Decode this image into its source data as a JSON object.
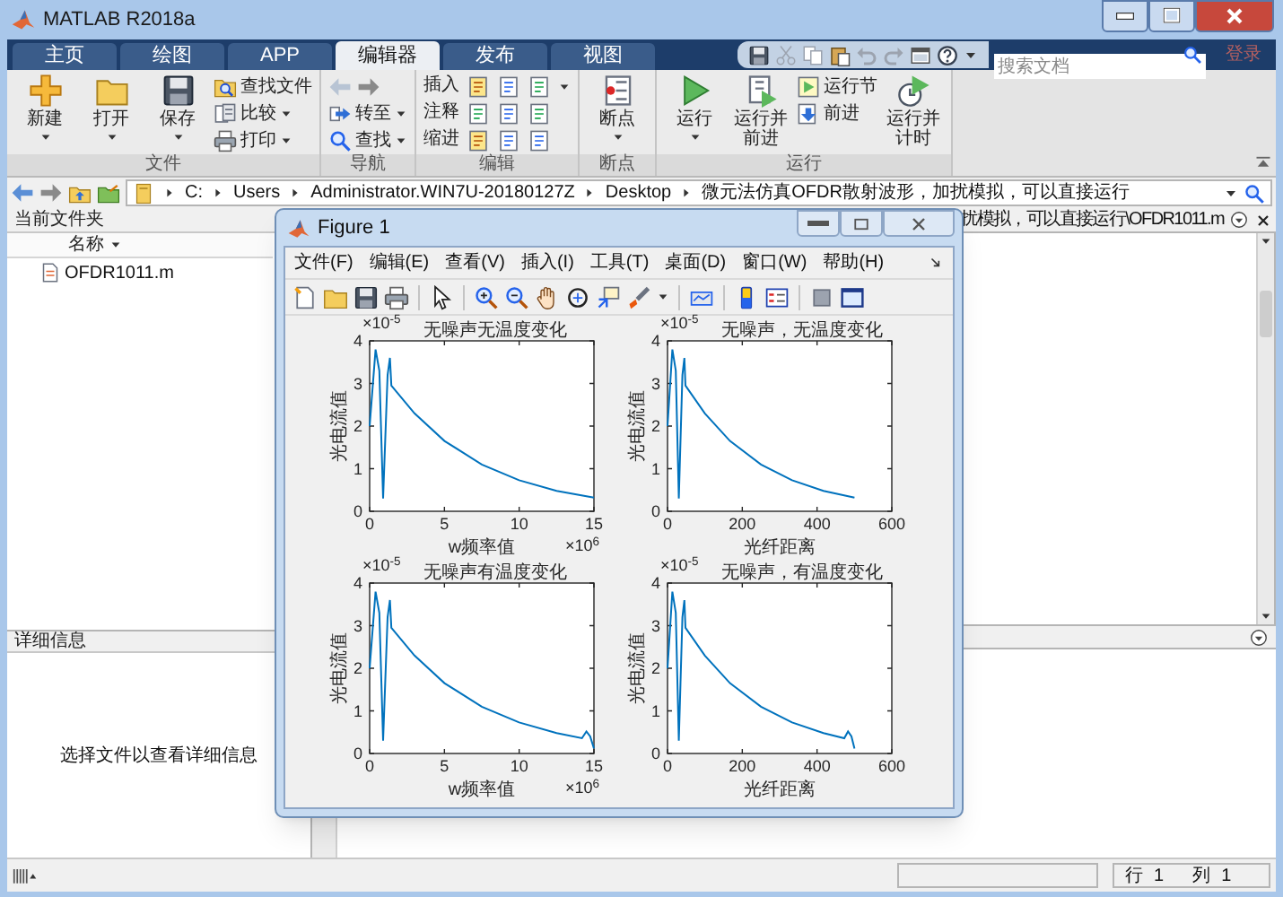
{
  "window": {
    "title": "MATLAB R2018a"
  },
  "tabs": [
    {
      "label": "主页",
      "selected": false
    },
    {
      "label": "绘图",
      "selected": false
    },
    {
      "label": "APP",
      "selected": false
    },
    {
      "label": "编辑器",
      "selected": true
    },
    {
      "label": "发布",
      "selected": false
    },
    {
      "label": "视图",
      "selected": false
    }
  ],
  "search": {
    "placeholder": "搜索文档"
  },
  "sign_in": "登录",
  "ribbon": {
    "groups": [
      {
        "label": "文件",
        "items": [
          {
            "kind": "large",
            "label": "新建",
            "dropdown": true
          },
          {
            "kind": "large",
            "label": "打开",
            "dropdown": true
          },
          {
            "kind": "large",
            "label": "保存",
            "dropdown": true
          },
          {
            "kind": "small",
            "label": "查找文件",
            "dropdown": false
          },
          {
            "kind": "small",
            "label": "比较",
            "dropdown": true
          },
          {
            "kind": "small",
            "label": "打印",
            "dropdown": true
          }
        ]
      },
      {
        "label": "导航",
        "items": [
          {
            "kind": "arrows",
            "disabled": true
          },
          {
            "kind": "small",
            "label": "转至",
            "dropdown": true
          },
          {
            "kind": "small",
            "label": "查找",
            "dropdown": true
          }
        ]
      },
      {
        "label": "编辑",
        "items": [
          {
            "kind": "tool_row",
            "label": "插入",
            "dropdown": true
          },
          {
            "kind": "tool_row",
            "label": "注释",
            "dropdown": false
          },
          {
            "kind": "tool_row",
            "label": "缩进",
            "dropdown": false
          }
        ]
      },
      {
        "label": "断点",
        "items": [
          {
            "kind": "large",
            "label": "断点",
            "dropdown": true
          }
        ]
      },
      {
        "label": "运行",
        "items": [
          {
            "kind": "large",
            "label": "运行",
            "dropdown": true
          },
          {
            "kind": "large",
            "label": "运行并前进",
            "dropdown": false
          },
          {
            "kind": "small",
            "label": "运行节",
            "dropdown": false
          },
          {
            "kind": "small",
            "label": "前进",
            "dropdown": false
          },
          {
            "kind": "large",
            "label": "运行并计时",
            "dropdown": false
          }
        ]
      }
    ]
  },
  "address": {
    "segments": [
      "C:",
      "Users",
      "Administrator.WIN7U-20180127Z",
      "Desktop",
      "微元法仿真OFDR散射波形，加扰模拟，可以直接运行"
    ]
  },
  "current_folder": {
    "title": "当前文件夹",
    "column": "名称",
    "files": [
      "OFDR1011.m"
    ]
  },
  "editor": {
    "title": "扰模拟，可以直接运行\\OFDR1011.m"
  },
  "details": {
    "title": "详细信息",
    "message": "选择文件以查看详细信息"
  },
  "status_bar": {
    "line_label": "行",
    "line": "1",
    "col_label": "列",
    "col": "1"
  },
  "figure": {
    "title": "Figure 1",
    "menu": [
      "文件(F)",
      "编辑(E)",
      "查看(V)",
      "插入(I)",
      "工具(T)",
      "桌面(D)",
      "窗口(W)",
      "帮助(H)"
    ],
    "plots": [
      {
        "y_multiplier": "×10$^{-5}$",
        "x_multiplier": "×10$^{6}$",
        "chart_data": {
          "type": "line",
          "title": "无噪声无温度变化",
          "xlabel": "w频率值",
          "ylabel": "光电流值",
          "x": [
            0,
            0.4,
            0.65,
            0.9,
            1.2,
            1.35,
            1.45,
            3,
            5,
            7.5,
            10,
            12.5,
            15
          ],
          "series": [
            {
              "color": "#0072bd",
              "values": [
                2,
                3.8,
                3.3,
                0.3,
                3.2,
                3.6,
                2.95,
                2.3,
                1.65,
                1.1,
                0.73,
                0.48,
                0.32
              ]
            }
          ],
          "xlim": [
            0,
            15
          ],
          "ylim": [
            0,
            4
          ],
          "xticks": [
            0,
            5,
            10,
            15
          ],
          "yticks": [
            0,
            1,
            2,
            3,
            4
          ]
        }
      },
      {
        "y_multiplier": "×10$^{-5}$",
        "chart_data": {
          "type": "line",
          "title": "无噪声，无温度变化",
          "xlabel": "光纤距离",
          "ylabel": "光电流值",
          "x": [
            0,
            13,
            22,
            30,
            40,
            45,
            48,
            100,
            167,
            250,
            333,
            417,
            500
          ],
          "series": [
            {
              "color": "#0072bd",
              "values": [
                2,
                3.8,
                3.3,
                0.3,
                3.2,
                3.6,
                2.95,
                2.3,
                1.65,
                1.1,
                0.73,
                0.48,
                0.32
              ]
            }
          ],
          "xlim": [
            0,
            600
          ],
          "ylim": [
            0,
            4
          ],
          "xticks": [
            0,
            200,
            400,
            600
          ],
          "yticks": [
            0,
            1,
            2,
            3,
            4
          ]
        }
      },
      {
        "y_multiplier": "×10$^{-5}$",
        "x_multiplier": "×10$^{6}$",
        "chart_data": {
          "type": "line",
          "title": "无噪声有温度变化",
          "xlabel": "w频率值",
          "ylabel": "光电流值",
          "x": [
            0,
            0.4,
            0.65,
            0.9,
            1.2,
            1.35,
            1.45,
            3,
            5,
            7.5,
            10,
            12.5,
            14.2,
            14.5,
            14.75,
            15
          ],
          "series": [
            {
              "color": "#0072bd",
              "values": [
                2,
                3.8,
                3.3,
                0.3,
                3.2,
                3.6,
                2.95,
                2.3,
                1.65,
                1.1,
                0.73,
                0.48,
                0.36,
                0.52,
                0.4,
                0.12
              ]
            }
          ],
          "xlim": [
            0,
            15
          ],
          "ylim": [
            0,
            4
          ],
          "xticks": [
            0,
            5,
            10,
            15
          ],
          "yticks": [
            0,
            1,
            2,
            3,
            4
          ]
        }
      },
      {
        "y_multiplier": "×10$^{-5}$",
        "chart_data": {
          "type": "line",
          "title": "无噪声，有温度变化",
          "xlabel": "光纤距离",
          "ylabel": "光电流值",
          "x": [
            0,
            13,
            22,
            30,
            40,
            45,
            48,
            100,
            167,
            250,
            333,
            417,
            473,
            483,
            492,
            500
          ],
          "series": [
            {
              "color": "#0072bd",
              "values": [
                2,
                3.8,
                3.3,
                0.3,
                3.2,
                3.6,
                2.95,
                2.3,
                1.65,
                1.1,
                0.73,
                0.48,
                0.36,
                0.52,
                0.4,
                0.12
              ]
            }
          ],
          "xlim": [
            0,
            600
          ],
          "ylim": [
            0,
            4
          ],
          "xticks": [
            0,
            200,
            400,
            600
          ],
          "yticks": [
            0,
            1,
            2,
            3,
            4
          ]
        }
      }
    ]
  }
}
